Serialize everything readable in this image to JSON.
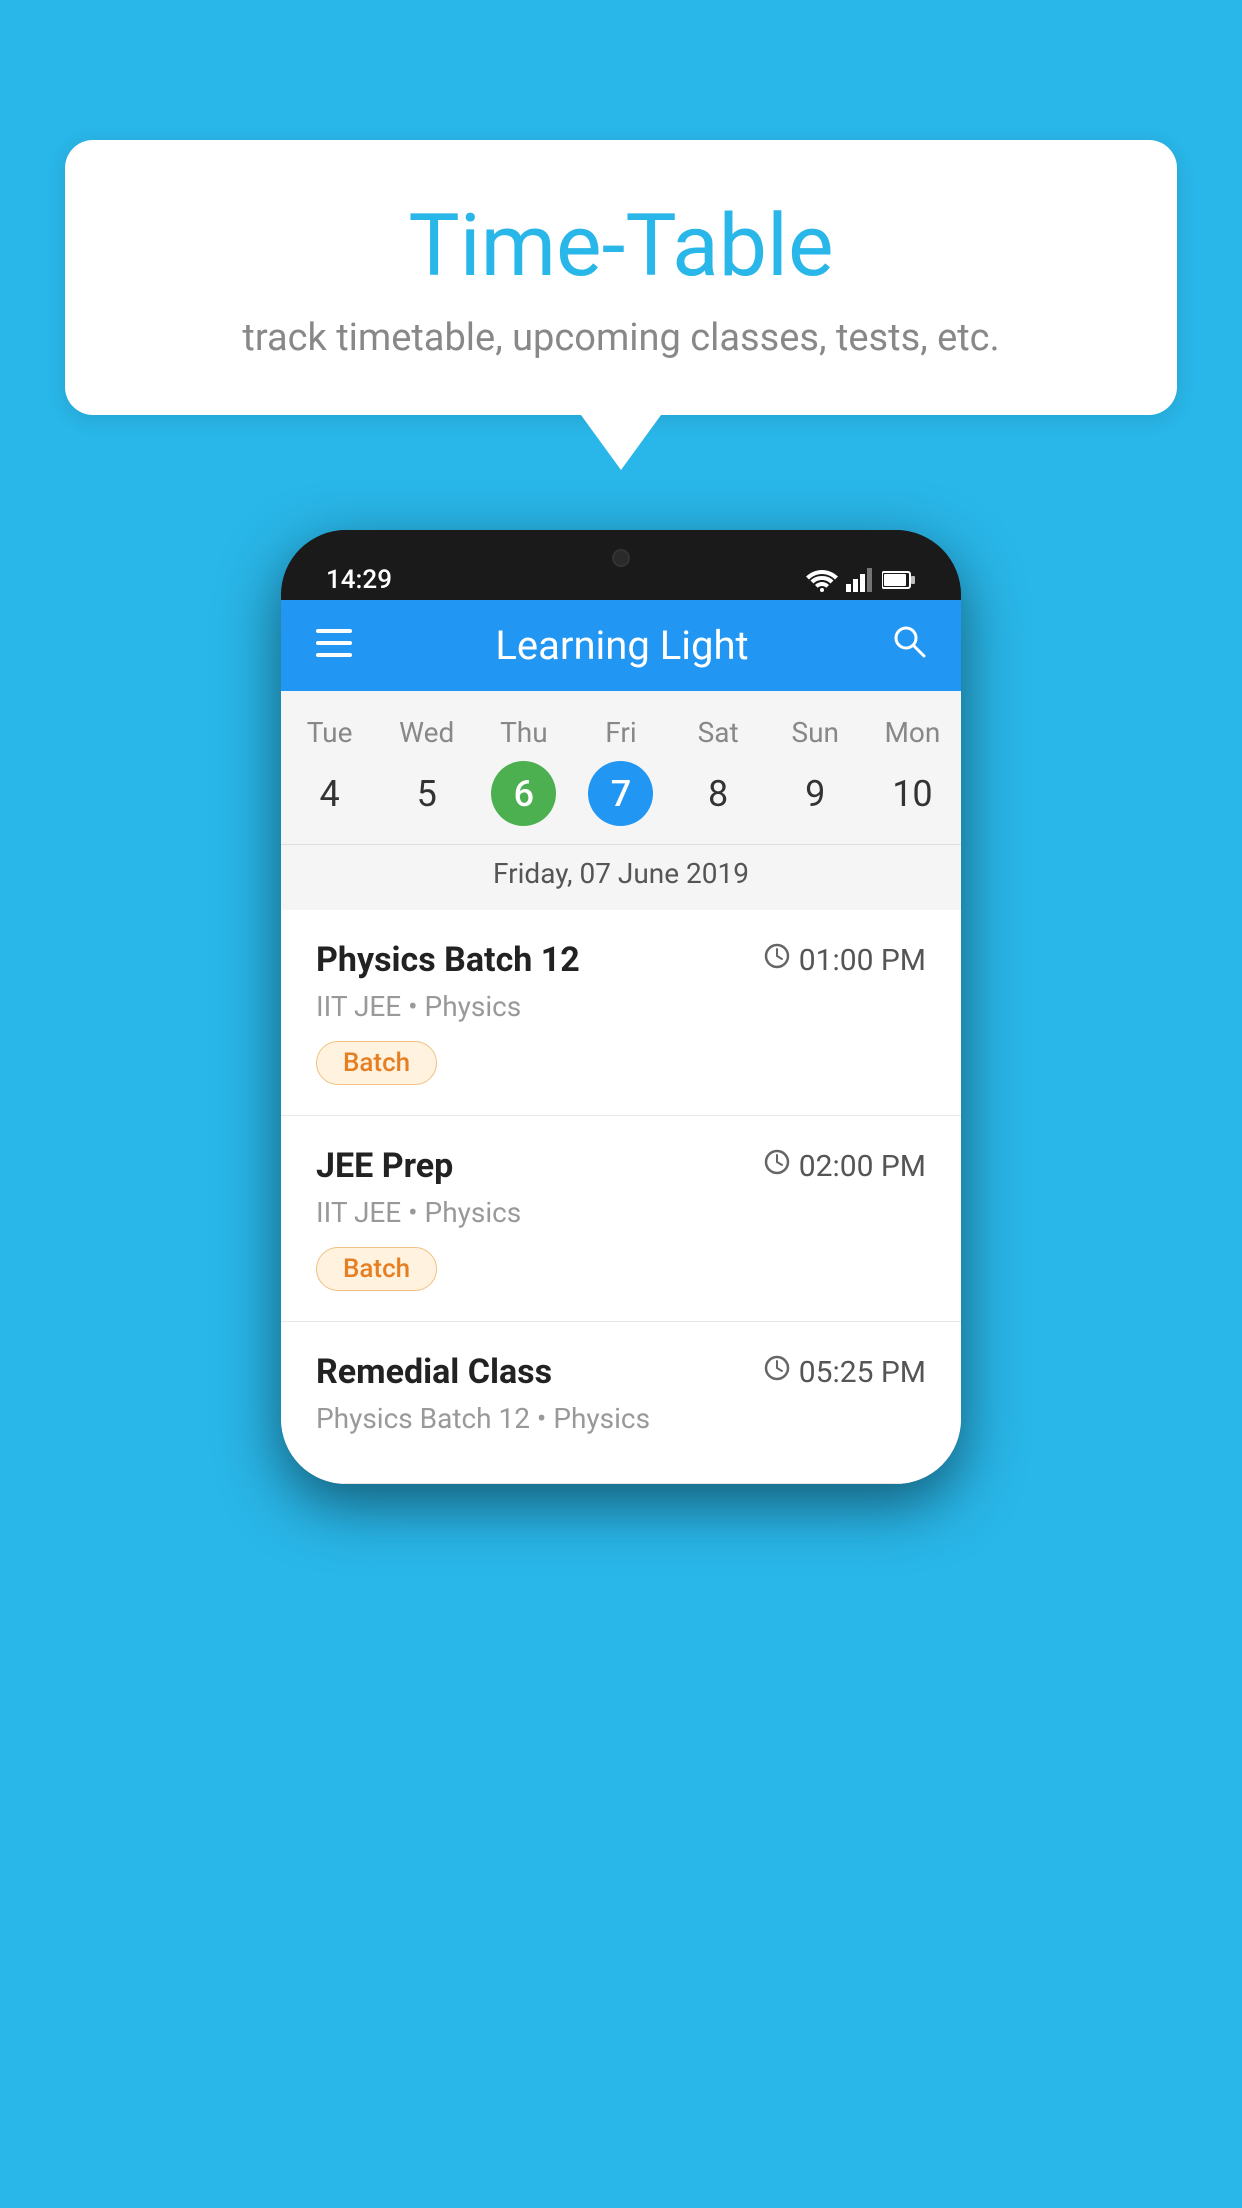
{
  "header": {
    "title": "Time-Table",
    "subtitle": "track timetable, upcoming classes, tests, etc."
  },
  "app": {
    "name": "Learning Light",
    "status_time": "14:29"
  },
  "calendar": {
    "selected_date_label": "Friday, 07 June 2019",
    "days": [
      {
        "label": "Tue",
        "num": "4",
        "state": "normal"
      },
      {
        "label": "Wed",
        "num": "5",
        "state": "normal"
      },
      {
        "label": "Thu",
        "num": "6",
        "state": "today"
      },
      {
        "label": "Fri",
        "num": "7",
        "state": "selected"
      },
      {
        "label": "Sat",
        "num": "8",
        "state": "normal"
      },
      {
        "label": "Sun",
        "num": "9",
        "state": "normal"
      },
      {
        "label": "Mon",
        "num": "10",
        "state": "normal"
      }
    ]
  },
  "schedule": [
    {
      "title": "Physics Batch 12",
      "time": "01:00 PM",
      "meta": "IIT JEE • Physics",
      "badge": "Batch"
    },
    {
      "title": "JEE Prep",
      "time": "02:00 PM",
      "meta": "IIT JEE • Physics",
      "badge": "Batch"
    },
    {
      "title": "Remedial Class",
      "time": "05:25 PM",
      "meta": "Physics Batch 12 • Physics",
      "badge": null
    }
  ],
  "colors": {
    "background": "#29b6e8",
    "app_bar": "#2196f3",
    "today_circle": "#4caf50",
    "selected_circle": "#2196f3",
    "badge_bg": "#fff3e0",
    "badge_text": "#e67e22"
  }
}
